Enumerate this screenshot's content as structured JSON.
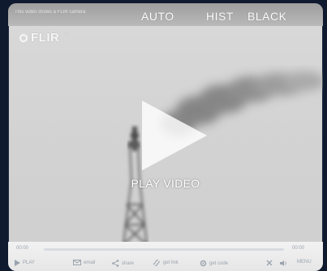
{
  "header": {
    "caption": "This video shows a FLIR camera",
    "modes": [
      "AUTO",
      "HIST",
      "BLACK"
    ]
  },
  "logo": {
    "text": "FLIR",
    "tm": "™"
  },
  "overlay": {
    "play_label": "PLAY VIDEO"
  },
  "controls": {
    "time_current": "00:00",
    "time_total": "00:00",
    "progress": 0.0,
    "play_label": "PLAY",
    "email_label": "email",
    "share_label": "share",
    "embed_label": "get link",
    "download_label": "get code",
    "menu_label": "MENU"
  },
  "colors": {
    "page_bg": "#0f1a2e",
    "video_bg": "#d6d6d6",
    "text_light": "#ffffff",
    "controls_bg": "#eeeeee",
    "controls_fg": "#9aa3ad"
  }
}
